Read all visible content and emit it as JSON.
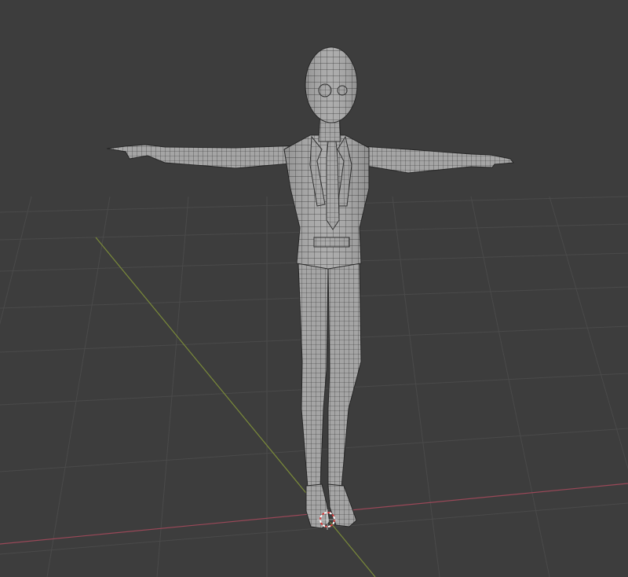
{
  "viewport": {
    "background_color": "#3d3d3d",
    "grid_color": "#4a4a4a",
    "axis_x_color": "#9a4858",
    "axis_y_color": "#7a8a3a",
    "mesh_fill_color": "#a9a9a9",
    "wire_color": "#2e2e2e",
    "shading_mode": "solid-wireframe",
    "origin_icon": "object-origin-icon",
    "model_pose": "t-pose"
  }
}
